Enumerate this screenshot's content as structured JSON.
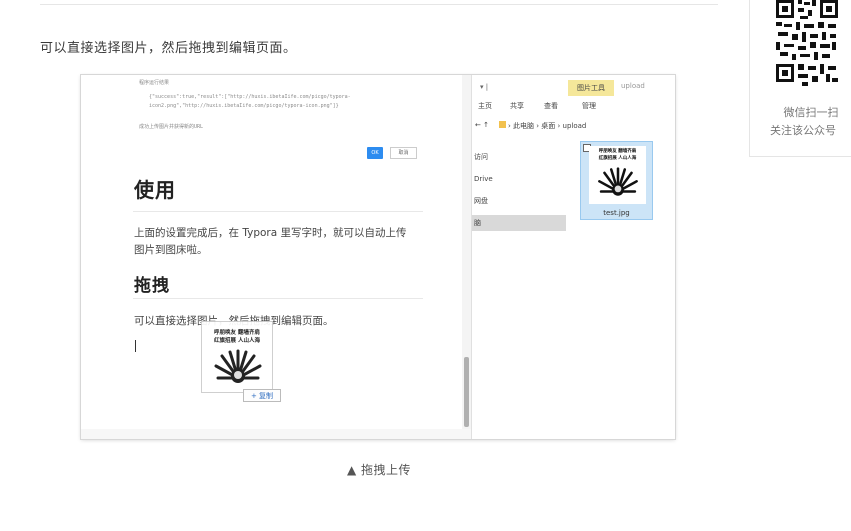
{
  "article": {
    "intro": "可以直接选择图片，然后拖拽到编辑页面。",
    "caption": "▲ 拖拽上传"
  },
  "sidebar": {
    "qr_caption_line1": "微信扫一扫",
    "qr_caption_line2": "关注该公众号"
  },
  "typora": {
    "result_label": "程序运行结果",
    "result_json_line1": "{\"success\":true,\"result\":[\"http://huxis.ibetaIife.com/picgo/typora-",
    "result_json_line2": "icon2.png\",\"http://huxis.ibetaIife.com/picgo/typora-icon.png\"]}",
    "success_note": "成功上传图片并获得新的URL",
    "ok_label": "OK",
    "cancel_label": "取消",
    "heading_use": "使用",
    "para_use_line1": "上面的设置完成后，在 Typora 里写字时，就可以自动上传",
    "para_use_line2": "图片到图床啦。",
    "heading_drag": "拖拽",
    "para_drag": "可以直接选择图片，然后拖拽到编辑页面。",
    "copy_tip": "+ 复制"
  },
  "meme": {
    "line1": "呼朋唤友 翻墙齐肩",
    "line2": "红旗招展 人山人海"
  },
  "explorer": {
    "quick_access_arrow": "▾ |",
    "picture_tools_tab": "图片工具",
    "window_title": "upload",
    "tabs": [
      "主页",
      "共享",
      "查看",
      "管理"
    ],
    "address_nav": "← ↑",
    "address_path": "› 此电脑 › 桌面 › upload",
    "nav_items": [
      "访问",
      "Drive",
      "网盘",
      "脑"
    ],
    "file_name": "test.jpg"
  }
}
